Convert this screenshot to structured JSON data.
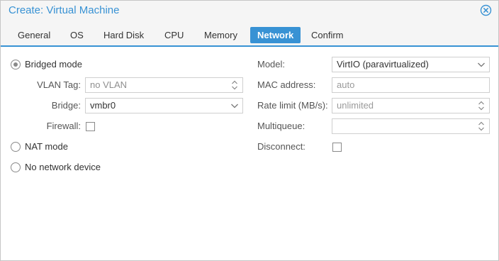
{
  "window": {
    "title": "Create: Virtual Machine"
  },
  "tabs": [
    {
      "label": "General"
    },
    {
      "label": "OS"
    },
    {
      "label": "Hard Disk"
    },
    {
      "label": "CPU"
    },
    {
      "label": "Memory"
    },
    {
      "label": "Network"
    },
    {
      "label": "Confirm"
    }
  ],
  "active_tab": "Network",
  "left": {
    "bridged_mode_label": "Bridged mode",
    "bridged_mode_checked": true,
    "vlan_tag_label": "VLAN Tag:",
    "vlan_tag_placeholder": "no VLAN",
    "bridge_label": "Bridge:",
    "bridge_value": "vmbr0",
    "firewall_label": "Firewall:",
    "firewall_checked": false,
    "nat_mode_label": "NAT mode",
    "no_network_label": "No network device"
  },
  "right": {
    "model_label": "Model:",
    "model_value": "VirtIO (paravirtualized)",
    "mac_label": "MAC address:",
    "mac_value": "auto",
    "rate_label": "Rate limit (MB/s):",
    "rate_value": "unlimited",
    "multiqueue_label": "Multiqueue:",
    "multiqueue_value": "",
    "disconnect_label": "Disconnect:",
    "disconnect_checked": false
  },
  "icons": {
    "close": "close-circle-icon",
    "dropdown": "chevron-down-icon",
    "spinner": "spinner-updown-icon"
  },
  "colors": {
    "accent": "#3892d4",
    "title": "#3892d4",
    "tab_bg": "#f5f5f5"
  }
}
